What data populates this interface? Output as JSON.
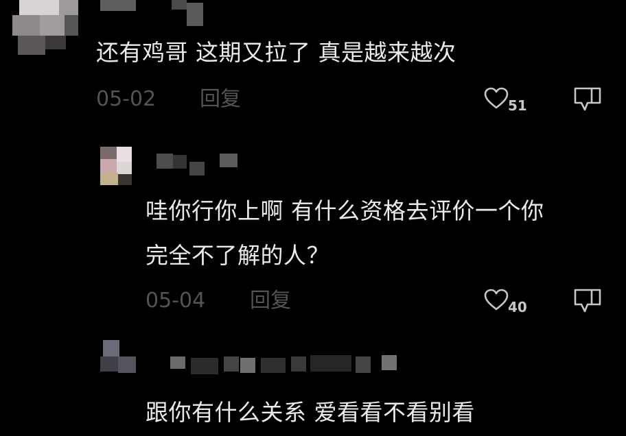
{
  "comments": [
    {
      "text": "还有鸡哥 这期又拉了 真是越来越次",
      "date": "05-02",
      "reply_label": "回复",
      "likes": "51",
      "icons": [
        "heart-icon",
        "dislike-icon"
      ]
    },
    {
      "text_lines": [
        "哇你行你上啊 有什么资格去评价一个你",
        "完全不了解的人？"
      ],
      "date": "05-04",
      "reply_label": "回复",
      "likes": "40",
      "icons": [
        "heart-icon",
        "dislike-icon"
      ]
    },
    {
      "text": "跟你有什么关系 爱看看不看别看"
    }
  ],
  "colors": {
    "background": "#000000",
    "text": "#eceaea",
    "meta": "#545454"
  }
}
